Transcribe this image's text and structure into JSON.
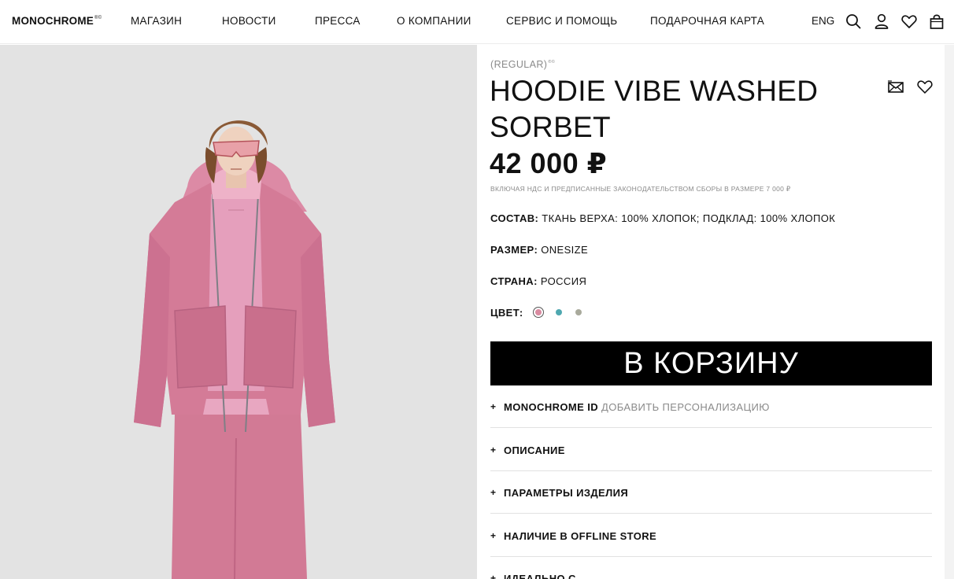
{
  "header": {
    "logo": "MONOCHROME",
    "logo_mark": "®©",
    "nav": [
      "МАГАЗИН",
      "НОВОСТИ",
      "ПРЕССА",
      "О КОМПАНИИ",
      "СЕРВИС И ПОМОЩЬ",
      "ПОДАРОЧНАЯ КАРТА"
    ],
    "lang": "ENG",
    "icons": [
      "search-icon",
      "user-icon",
      "heart-icon",
      "bag-icon"
    ]
  },
  "product": {
    "line": "(REGULAR)",
    "line_mark": "®©",
    "title": "HOODIE VIBE WASHED SORBET",
    "price": "42 000 ₽",
    "vat_note": "ВКЛЮЧАЯ НДС И ПРЕДПИСАННЫЕ ЗАКОНОДАТЕЛЬСТВОМ СБОРЫ В РАЗМЕРЕ 7 000 ₽",
    "composition_label": "СОСТАВ:",
    "composition_value": " ТКАНЬ ВЕРХА: 100% ХЛОПОК; ПОДКЛАД: 100% ХЛОПОК",
    "size_label": "РАЗМЕР:",
    "size_value": " ONESIZE",
    "country_label": "СТРАНА:",
    "country_value": " РОССИЯ",
    "color_label": "ЦВЕТ:",
    "colors": [
      {
        "name": "pink",
        "hex": "#d98aa0",
        "selected": true
      },
      {
        "name": "teal",
        "hex": "#4fa8b0",
        "selected": false
      },
      {
        "name": "grey",
        "hex": "#a9aa9c",
        "selected": false
      }
    ],
    "actions": [
      "share-mail-icon",
      "wishlist-heart-icon"
    ],
    "add_to_cart": "В КОРЗИНУ"
  },
  "accordion": [
    {
      "label": "MONOCHROME ID",
      "sub": "ДОБАВИТЬ ПЕРСОНАЛИЗАЦИЮ"
    },
    {
      "label": "ОПИСАНИЕ",
      "sub": ""
    },
    {
      "label": "ПАРАМЕТРЫ ИЗДЕЛИЯ",
      "sub": ""
    },
    {
      "label": "НАЛИЧИЕ В OFFLINE STORE",
      "sub": ""
    },
    {
      "label": "ИДЕАЛЬНО С",
      "sub": ""
    }
  ],
  "accordion_plus": "+",
  "colors": {
    "accent": "#000000",
    "muted_text": "#8a8a8a",
    "garment_pink": "#d27a95"
  }
}
